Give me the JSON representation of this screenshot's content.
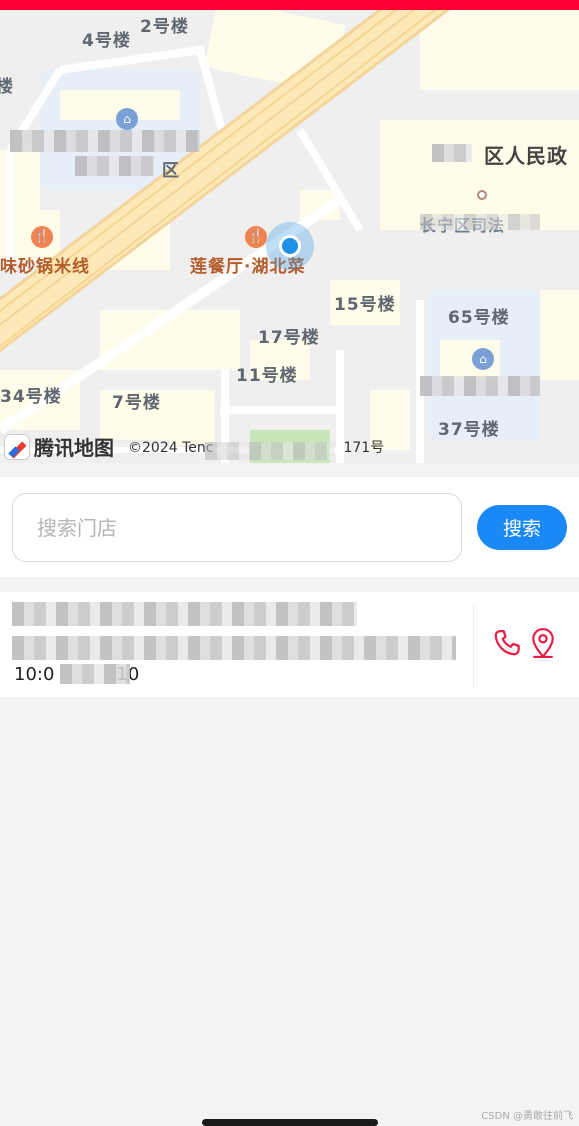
{
  "colors": {
    "accent": "#1b89f5",
    "top_bar": "#ff0036",
    "action_icons": "#e91e45"
  },
  "map": {
    "labels": [
      {
        "key": "b4",
        "text": "4号楼"
      },
      {
        "key": "b2",
        "text": "2号楼"
      },
      {
        "key": "b_left",
        "text": "楼"
      },
      {
        "key": "district",
        "text": "区人民政"
      },
      {
        "key": "court",
        "text": "长宁区司法"
      },
      {
        "key": "noodles",
        "text": "味砂锅米线"
      },
      {
        "key": "restaurant",
        "text": "莲餐厅·湖北菜"
      },
      {
        "key": "b15",
        "text": "15号楼"
      },
      {
        "key": "b65",
        "text": "65号楼"
      },
      {
        "key": "b17",
        "text": "17号楼"
      },
      {
        "key": "b11",
        "text": "11号楼"
      },
      {
        "key": "b34",
        "text": "34号楼"
      },
      {
        "key": "b7",
        "text": "7号楼"
      },
      {
        "key": "b37",
        "text": "37号楼"
      },
      {
        "key": "community",
        "text": "区"
      }
    ],
    "logo_text": "腾讯地图",
    "copyright": "©2024 Tenc",
    "copyright_tail": "171号"
  },
  "search": {
    "placeholder": "搜索门店",
    "button_label": "搜索"
  },
  "store": {
    "hours_start": "10:0",
    "hours_end": "10"
  },
  "watermark": "CSDN @勇敢往前飞"
}
